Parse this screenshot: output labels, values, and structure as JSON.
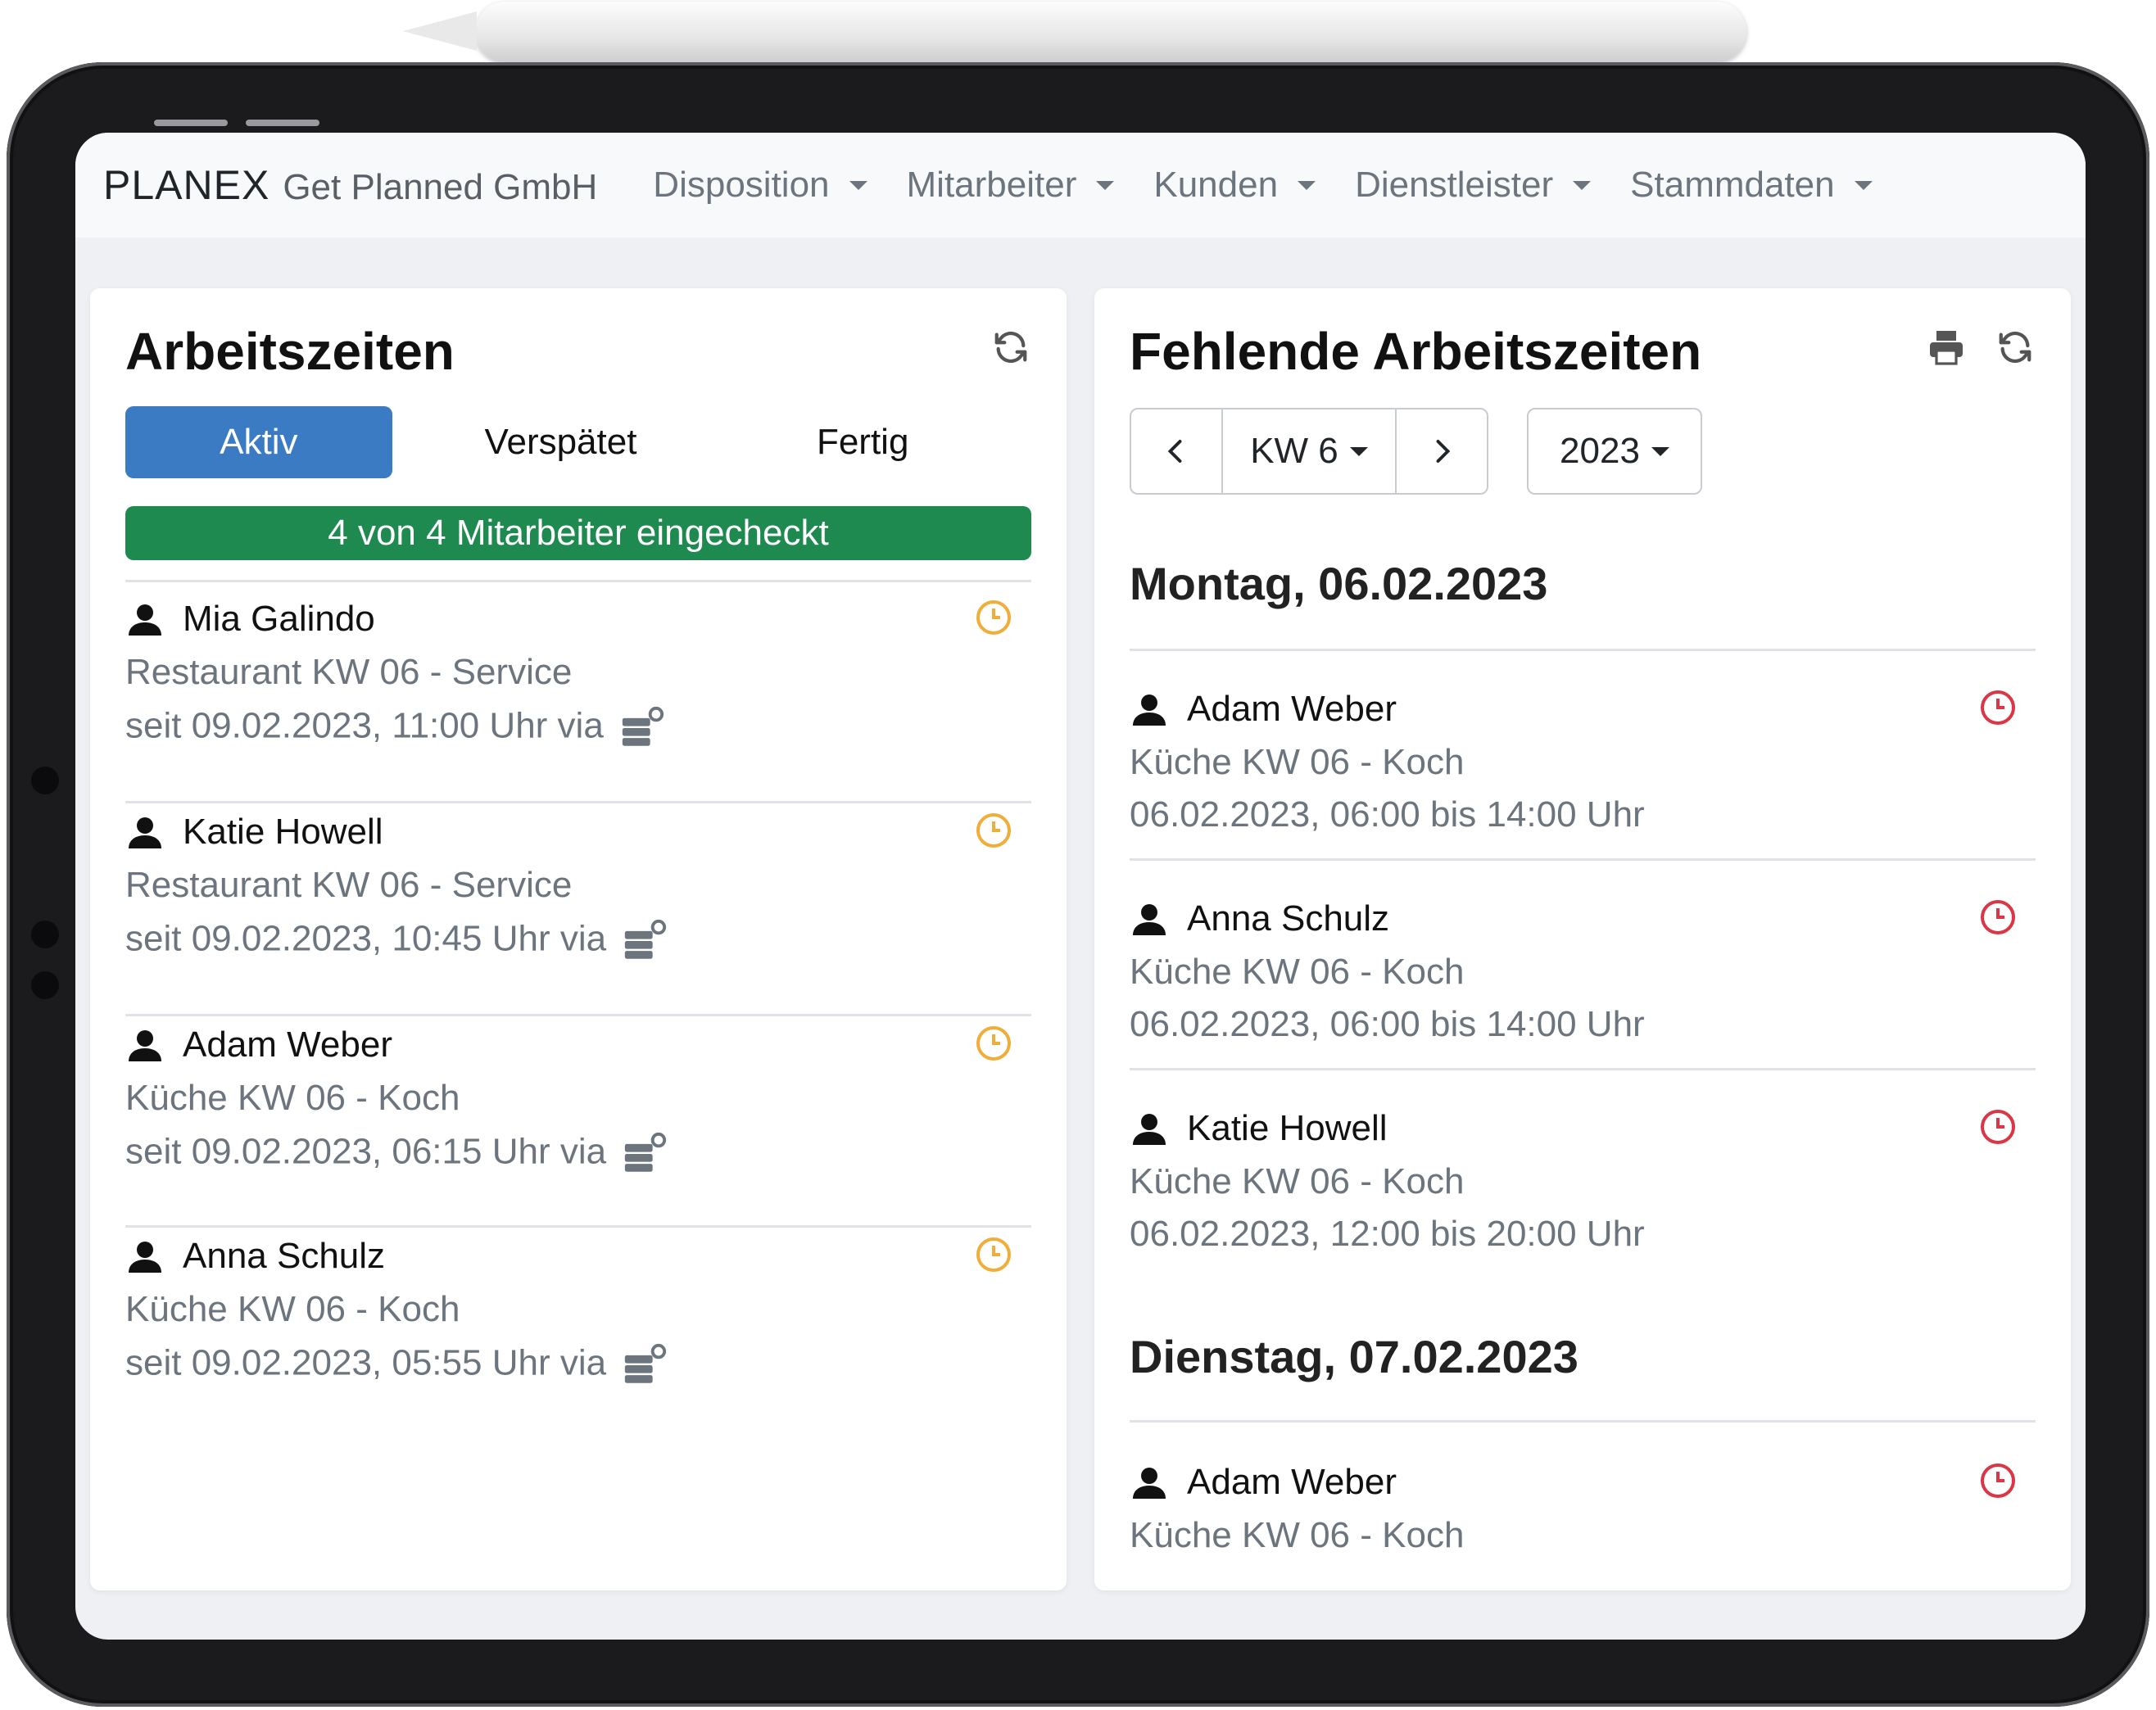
{
  "navbar": {
    "brand_name": "PLANEX",
    "brand_sub": "Get Planned GmbH",
    "items": [
      {
        "label": "Disposition"
      },
      {
        "label": "Mitarbeiter"
      },
      {
        "label": "Kunden"
      },
      {
        "label": "Dienstleister"
      },
      {
        "label": "Stammdaten"
      }
    ]
  },
  "left": {
    "title": "Arbeitszeiten",
    "tabs": [
      {
        "label": "Aktiv",
        "active": true
      },
      {
        "label": "Verspätet",
        "active": false
      },
      {
        "label": "Fertig",
        "active": false
      }
    ],
    "checked_in": "4 von 4 Mitarbeiter eingecheckt",
    "entries": [
      {
        "name": "Mia Galindo",
        "location": "Restaurant KW 06 - Service",
        "since": "seit 09.02.2023, 11:00 Uhr via"
      },
      {
        "name": "Katie Howell",
        "location": "Restaurant KW 06 - Service",
        "since": "seit 09.02.2023, 10:45 Uhr via"
      },
      {
        "name": "Adam Weber",
        "location": "Küche KW 06 - Koch",
        "since": "seit 09.02.2023, 06:15 Uhr via"
      },
      {
        "name": "Anna Schulz",
        "location": "Küche KW 06 - Koch",
        "since": "seit 09.02.2023, 05:55 Uhr via"
      }
    ]
  },
  "right": {
    "title": "Fehlende Arbeitszeiten",
    "week_label": "KW 6",
    "year_label": "2023",
    "days": [
      {
        "heading": "Montag, 06.02.2023",
        "entries": [
          {
            "name": "Adam Weber",
            "location": "Küche KW 06 - Koch",
            "time": "06.02.2023, 06:00 bis 14:00 Uhr"
          },
          {
            "name": "Anna Schulz",
            "location": "Küche KW 06 - Koch",
            "time": "06.02.2023, 06:00 bis 14:00 Uhr"
          },
          {
            "name": "Katie Howell",
            "location": "Küche KW 06 - Koch",
            "time": "06.02.2023, 12:00 bis 20:00 Uhr"
          }
        ]
      },
      {
        "heading": "Dienstag, 07.02.2023",
        "entries": [
          {
            "name": "Adam Weber",
            "location": "Küche KW 06 - Koch"
          }
        ]
      }
    ]
  },
  "colors": {
    "primary": "#3a7bc4",
    "success": "#1e8a50",
    "warning_clock": "#f0ad3a",
    "danger_clock": "#dc3545",
    "muted_text": "#6c757d"
  }
}
